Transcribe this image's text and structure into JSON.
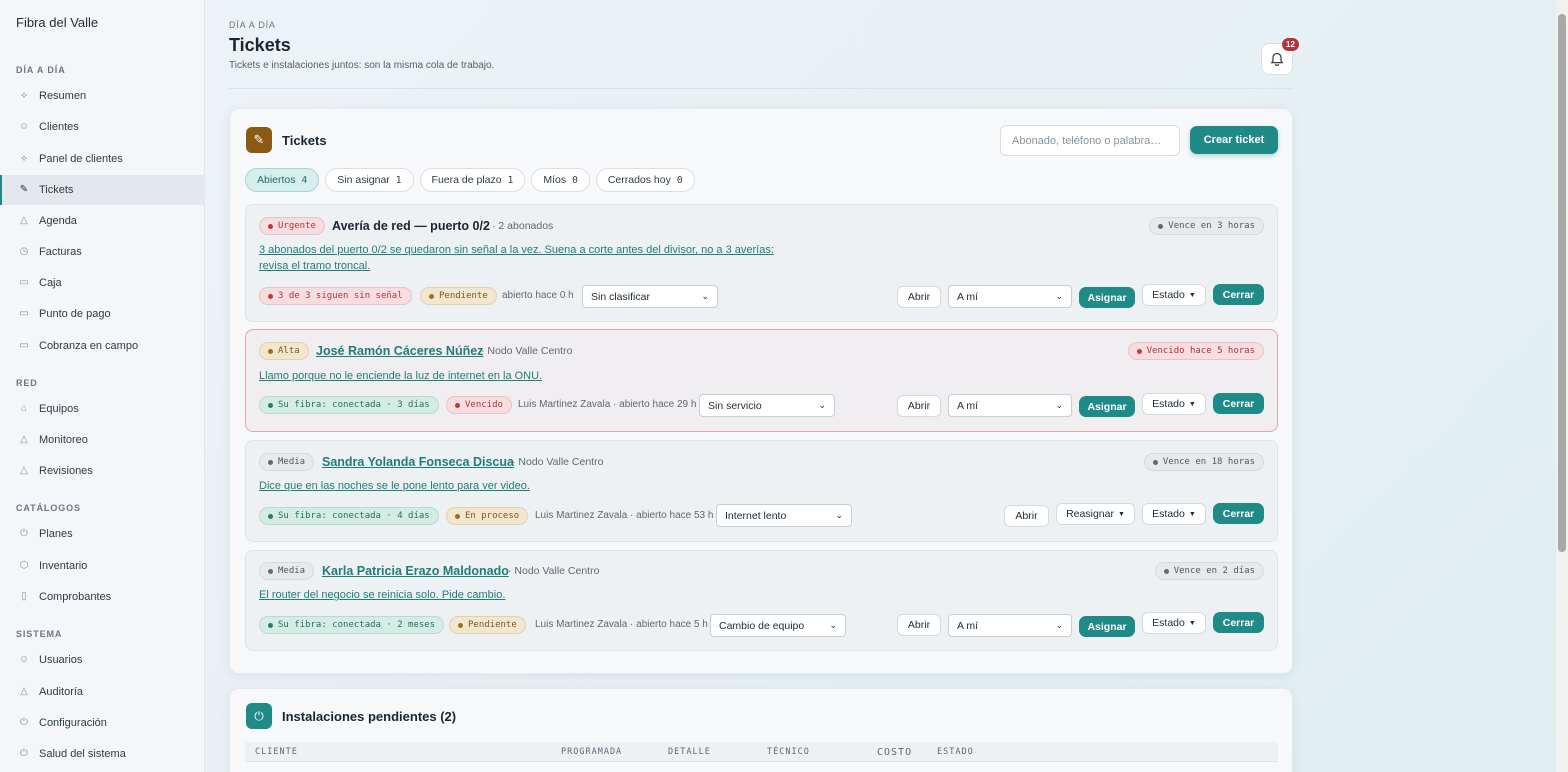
{
  "brand": "Fibra del Valle",
  "sidebar": {
    "sections": [
      {
        "title": "DÍA A DÍA"
      },
      {
        "title": "RED"
      },
      {
        "title": "CATÁLOGOS"
      },
      {
        "title": "SISTEMA"
      }
    ],
    "items": [
      {
        "label": "Resumen",
        "icon": "pulse-icon"
      },
      {
        "label": "Clientes",
        "icon": "users-icon"
      },
      {
        "label": "Panel de clientes",
        "icon": "pulse-icon"
      },
      {
        "label": "Tickets",
        "icon": "wrench-icon",
        "active": true
      },
      {
        "label": "Agenda",
        "icon": "warning-icon"
      },
      {
        "label": "Facturas",
        "icon": "clock-icon"
      },
      {
        "label": "Caja",
        "icon": "cash-icon"
      },
      {
        "label": "Punto de pago",
        "icon": "cash-icon"
      },
      {
        "label": "Cobranza en campo",
        "icon": "cash-icon"
      },
      {
        "label": "Equipos",
        "icon": "device-icon"
      },
      {
        "label": "Monitoreo",
        "icon": "warning-icon"
      },
      {
        "label": "Revisiones",
        "icon": "warning-icon"
      },
      {
        "label": "Planes",
        "icon": "power-icon"
      },
      {
        "label": "Inventario",
        "icon": "box-icon"
      },
      {
        "label": "Comprobantes",
        "icon": "document-icon"
      },
      {
        "label": "Usuarios",
        "icon": "users-icon"
      },
      {
        "label": "Auditoría",
        "icon": "warning-icon"
      },
      {
        "label": "Configuración",
        "icon": "power-icon"
      },
      {
        "label": "Salud del sistema",
        "icon": "power-icon"
      }
    ]
  },
  "header": {
    "crumb": "DÍA A DÍA",
    "title": "Tickets",
    "subtitle": "Tickets e instalaciones juntos: son la misma cola de trabajo.",
    "notifications": "12"
  },
  "tickets_card": {
    "title": "Tickets",
    "search_placeholder": "Abonado, teléfono o palabra…",
    "create_label": "Crear ticket",
    "tabs": [
      {
        "label": "Abiertos",
        "count": "4",
        "active": true
      },
      {
        "label": "Sin asignar",
        "count": "1"
      },
      {
        "label": "Fuera de plazo",
        "count": "1"
      },
      {
        "label": "Míos",
        "count": "0"
      },
      {
        "label": "Cerrados hoy",
        "count": "0"
      }
    ],
    "rows": [
      {
        "priority": "Urgente",
        "title": "Avería de red — puerto 0/2",
        "sub": "· 2 abonados",
        "due": "Vence en 3 horas",
        "desc1": "3 abonados del puerto 0/2 se quedaron sin señal a la vez. Suena a corte antes del divisor, no a 3 averías:",
        "desc2": "revisa el tramo troncal.",
        "tag1": "3 de 3 siguen sin señal",
        "tag2": "Pendiente",
        "meta": "abierto hace 0 h",
        "category": "Sin clasificar",
        "assignee": "A mí",
        "assign_label": "Asignar"
      },
      {
        "priority": "Alta",
        "title": "José Ramón Cáceres Núñez",
        "sub": "· Nodo Valle Centro",
        "due": "Vencido hace 5 horas",
        "desc1": "Llamo porque no le enciende la luz de internet en la ONU.",
        "tag1": "Su fibra: conectada · 3 días",
        "tag2": "Vencido",
        "meta": "Luis Martinez Zavala · abierto hace 29 h",
        "category": "Sin servicio",
        "assignee": "A mí",
        "assign_label": "Asignar"
      },
      {
        "priority": "Media",
        "title": "Sandra Yolanda Fonseca Discua",
        "sub": "· Nodo Valle Centro",
        "due": "Vence en 18 horas",
        "desc1": "Dice que en las noches se le pone lento para ver video.",
        "tag1": "Su fibra: conectada · 4 días",
        "tag2": "En proceso",
        "meta": "Luis Martinez Zavala · abierto hace 53 h",
        "category": "Internet lento",
        "reassign_label": "Reasignar"
      },
      {
        "priority": "Media",
        "title": "Karla Patricia Erazo Maldonado",
        "sub": "· Nodo Valle Centro",
        "due": "Vence en 2 días",
        "desc1": "El router del negocio se reinicia solo. Pide cambio.",
        "tag1": "Su fibra: conectada · 2 meses",
        "tag2": "Pendiente",
        "meta": "Luis Martinez Zavala · abierto hace 5 h",
        "category": "Cambio de equipo",
        "assignee": "A mí",
        "assign_label": "Asignar"
      }
    ],
    "open_label": "Abrir",
    "state_label": "Estado",
    "close_label": "Cerrar"
  },
  "installs_card": {
    "title": "Instalaciones pendientes (2)",
    "columns": [
      "CLIENTE",
      "PROGRAMADA",
      "DETALLE",
      "TÉCNICO",
      "COSTO",
      "ESTADO"
    ]
  }
}
